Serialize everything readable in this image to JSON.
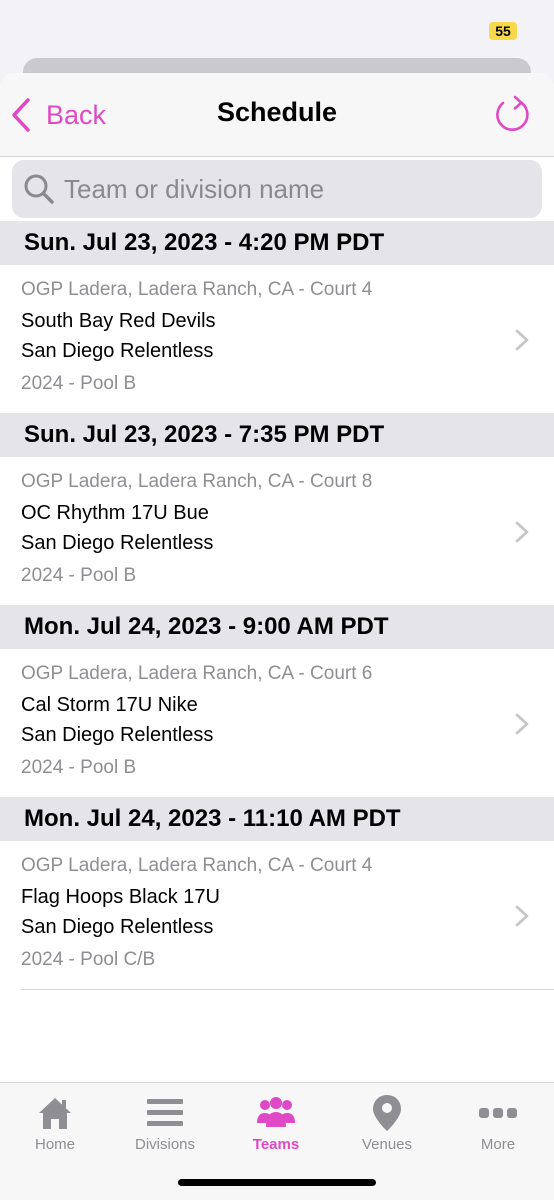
{
  "status_bar": {
    "battery": "55"
  },
  "nav": {
    "back_label": "Back",
    "title": "Schedule"
  },
  "search": {
    "placeholder": "Team or division name",
    "value": ""
  },
  "accent_color": "#e049c6",
  "sections": [
    {
      "header": "Sun. Jul 23, 2023 - 4:20 PM PDT",
      "game": {
        "venue": "OGP Ladera, Ladera Ranch, CA - Court 4",
        "team1": "South Bay Red Devils",
        "team2": "San Diego Relentless",
        "pool": "2024 - Pool B"
      }
    },
    {
      "header": "Sun. Jul 23, 2023 - 7:35 PM PDT",
      "game": {
        "venue": "OGP Ladera, Ladera Ranch, CA - Court 8",
        "team1": "OC Rhythm 17U Bue",
        "team2": "San Diego Relentless",
        "pool": "2024 - Pool B"
      }
    },
    {
      "header": "Mon. Jul 24, 2023 - 9:00 AM PDT",
      "game": {
        "venue": "OGP Ladera, Ladera Ranch, CA - Court 6",
        "team1": "Cal Storm 17U Nike",
        "team2": "San Diego Relentless",
        "pool": "2024 - Pool B"
      }
    },
    {
      "header": "Mon. Jul 24, 2023 - 11:10 AM PDT",
      "game": {
        "venue": "OGP Ladera, Ladera Ranch, CA - Court 4",
        "team1": "Flag Hoops Black 17U",
        "team2": "San Diego Relentless",
        "pool": "2024 - Pool C/B"
      }
    }
  ],
  "tabs": [
    {
      "label": "Home",
      "icon": "home-icon",
      "active": false
    },
    {
      "label": "Divisions",
      "icon": "list-icon",
      "active": false
    },
    {
      "label": "Teams",
      "icon": "people-icon",
      "active": true
    },
    {
      "label": "Venues",
      "icon": "location-pin-icon",
      "active": false
    },
    {
      "label": "More",
      "icon": "more-dots-icon",
      "active": false
    }
  ]
}
